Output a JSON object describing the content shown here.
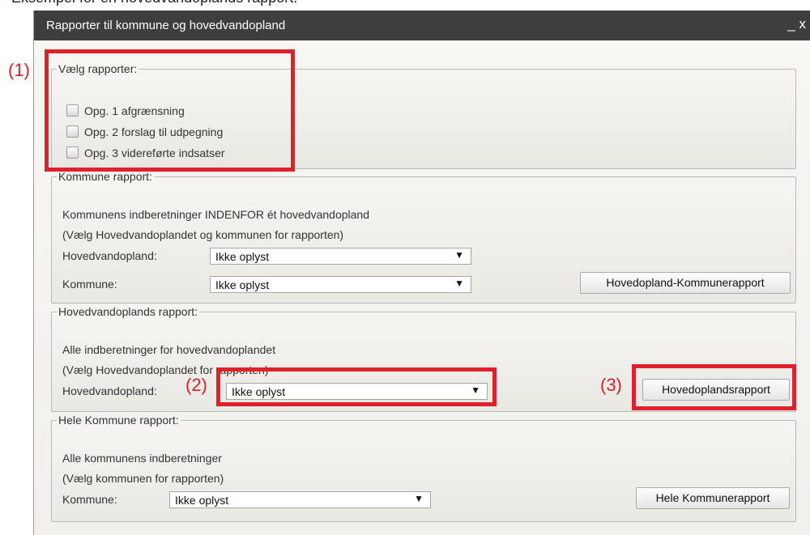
{
  "caption": "Eksempel for en hovedvandoplands rapport.",
  "dialog": {
    "title": "Rapporter til kommune og hovedvandopland",
    "close_label": "_ x"
  },
  "reports_group": {
    "legend": "Vælg rapporter:",
    "checkboxes": [
      {
        "label": "Opg. 1 afgrænsning",
        "checked": false
      },
      {
        "label": "Opg. 2 forslag til udpegning",
        "checked": false
      },
      {
        "label": "Opg. 3 videreførte indsatser",
        "checked": false
      }
    ]
  },
  "kommune_rapport": {
    "legend": "Kommune rapport:",
    "line1": "Kommunens indberetninger INDENFOR ét hovedvandopland",
    "line2": "(Vælg Hovedvandoplandet og kommunen for rapporten)",
    "hovedvandopland_label": "Hovedvandopland:",
    "hovedvandopland_value": "Ikke oplyst",
    "kommune_label": "Kommune:",
    "kommune_value": "Ikke oplyst",
    "button": "Hovedopland-Kommunerapport"
  },
  "hovedvandoplands_rapport": {
    "legend": "Hovedvandoplands rapport:",
    "line1": "Alle indberetninger for hovedvandoplandet",
    "line2": "(Vælg Hovedvandoplandet for rapporten)",
    "hovedvandopland_label": "Hovedvandopland:",
    "hovedvandopland_value": "Ikke oplyst",
    "button": "Hovedoplandsrapport"
  },
  "hele_kommune_rapport": {
    "legend": "Hele Kommune rapport:",
    "line1": "Alle kommunens indberetninger",
    "line2": "(Vælg kommunen for rapporten)",
    "kommune_label": "Kommune:",
    "kommune_value": "Ikke oplyst",
    "button": "Hele Kommunerapport"
  },
  "markers": {
    "m1": "(1)",
    "m2": "(2)",
    "m3": "(3)"
  },
  "colors": {
    "highlight": "#e0212a",
    "titlebar": "#3e3e3e"
  },
  "icons": {
    "dropdown": "triangle-down-icon",
    "close": "close-icon"
  }
}
